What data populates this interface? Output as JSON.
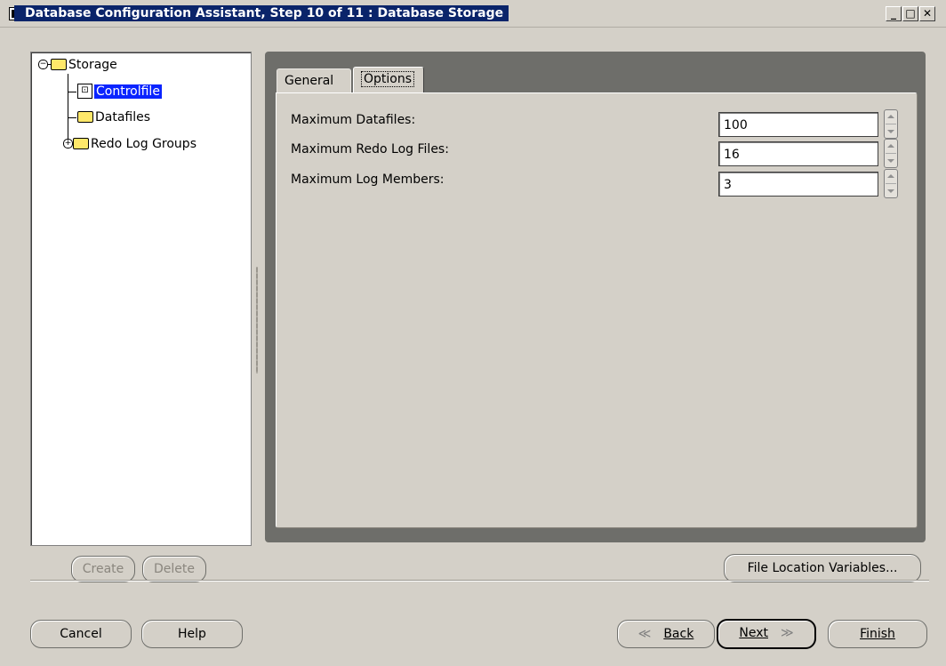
{
  "window": {
    "title": "Database Configuration Assistant, Step 10 of 11 : Database Storage",
    "controls": {
      "minimize": "_",
      "maximize": "□",
      "close": "✕"
    }
  },
  "tree": {
    "root": {
      "label": "Storage",
      "expanded": true
    },
    "items": [
      {
        "label": "Controlfile",
        "selected": true,
        "icon": "controlfile-icon"
      },
      {
        "label": "Datafiles",
        "icon": "folder-icon"
      },
      {
        "label": "Redo Log Groups",
        "icon": "folder-icon",
        "expandable": true
      }
    ]
  },
  "tree_buttons": {
    "create": "Create",
    "delete": "Delete"
  },
  "tabs": [
    {
      "label": "General",
      "active": false
    },
    {
      "label": "Options",
      "active": true
    }
  ],
  "options": {
    "max_datafiles_label": "Maximum Datafiles:",
    "max_datafiles_value": "100",
    "max_redo_label": "Maximum Redo Log Files:",
    "max_redo_value": "16",
    "max_members_label": "Maximum Log Members:",
    "max_members_value": "3"
  },
  "file_location_button": "File Location Variables...",
  "footer": {
    "cancel": "Cancel",
    "help": "Help",
    "back": "Back",
    "next": "Next",
    "finish": "Finish"
  },
  "colors": {
    "window_bg": "#d4d0c8",
    "title_highlight": "#0a246a",
    "selection": "#0a24ff",
    "panel_dark": "#6e6e6a"
  }
}
